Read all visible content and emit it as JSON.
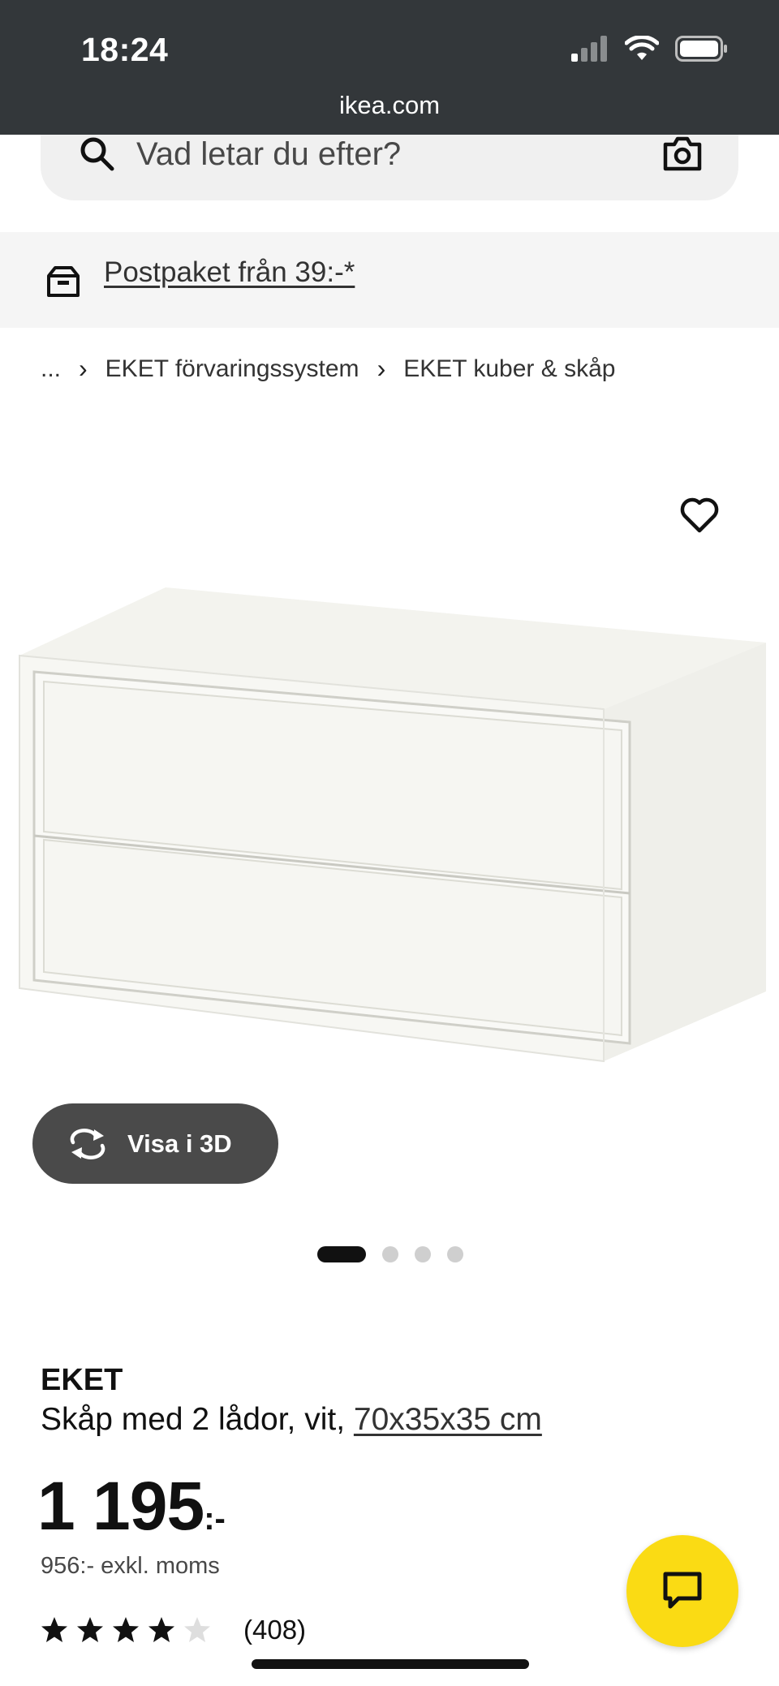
{
  "status_bar": {
    "time": "18:24"
  },
  "browser": {
    "url": "ikea.com"
  },
  "search": {
    "placeholder": "Vad letar du efter?"
  },
  "promo": {
    "text": "Postpaket från 39:-*"
  },
  "breadcrumb": {
    "ellipsis": "...",
    "items": [
      "EKET förvaringssystem",
      "EKET kuber & skåp"
    ]
  },
  "gallery": {
    "view_3d_label": "Visa i 3D",
    "total_images": 4,
    "active_index": 0
  },
  "product": {
    "name": "EKET",
    "description": "Skåp med 2 lådor, vit, ",
    "dimensions": "70x35x35 cm",
    "price": "1 195",
    "price_suffix": ":-",
    "price_excl_vat": "956:- exkl. moms",
    "rating": 4,
    "rating_max": 5,
    "review_count": "(408)"
  },
  "colors": {
    "top_bar": "#33373a",
    "chat_button": "#fadb14",
    "button_3d": "#4a4a4a"
  },
  "icons": {
    "search": "search-icon",
    "camera": "camera-icon",
    "delivery": "delivery-box-icon",
    "favorite": "heart-icon",
    "rotate": "rotate-3d-icon",
    "chat": "chat-icon",
    "star": "star-icon"
  }
}
